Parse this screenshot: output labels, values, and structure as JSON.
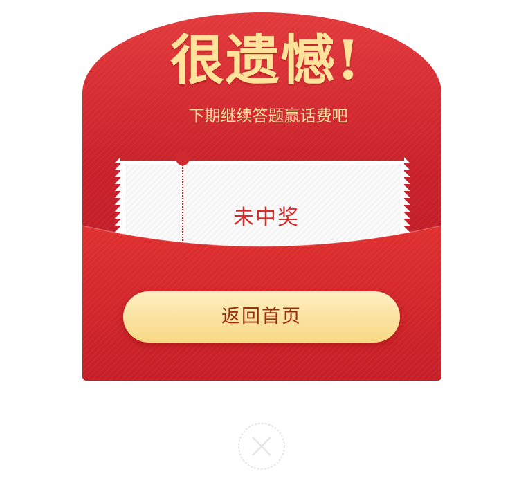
{
  "modal": {
    "title": "很遗憾!",
    "subtitle": "下期继续答题赢话费吧",
    "ticket_text": "未中奖",
    "cta_label": "返回首页"
  },
  "icons": {
    "close": "close-icon"
  },
  "colors": {
    "envelope_red": "#d8262c",
    "title_gold": "#ffe39a",
    "ticket_text_red": "#d52c2c",
    "button_gold": "#f7d884",
    "button_text": "#9a2f12"
  }
}
